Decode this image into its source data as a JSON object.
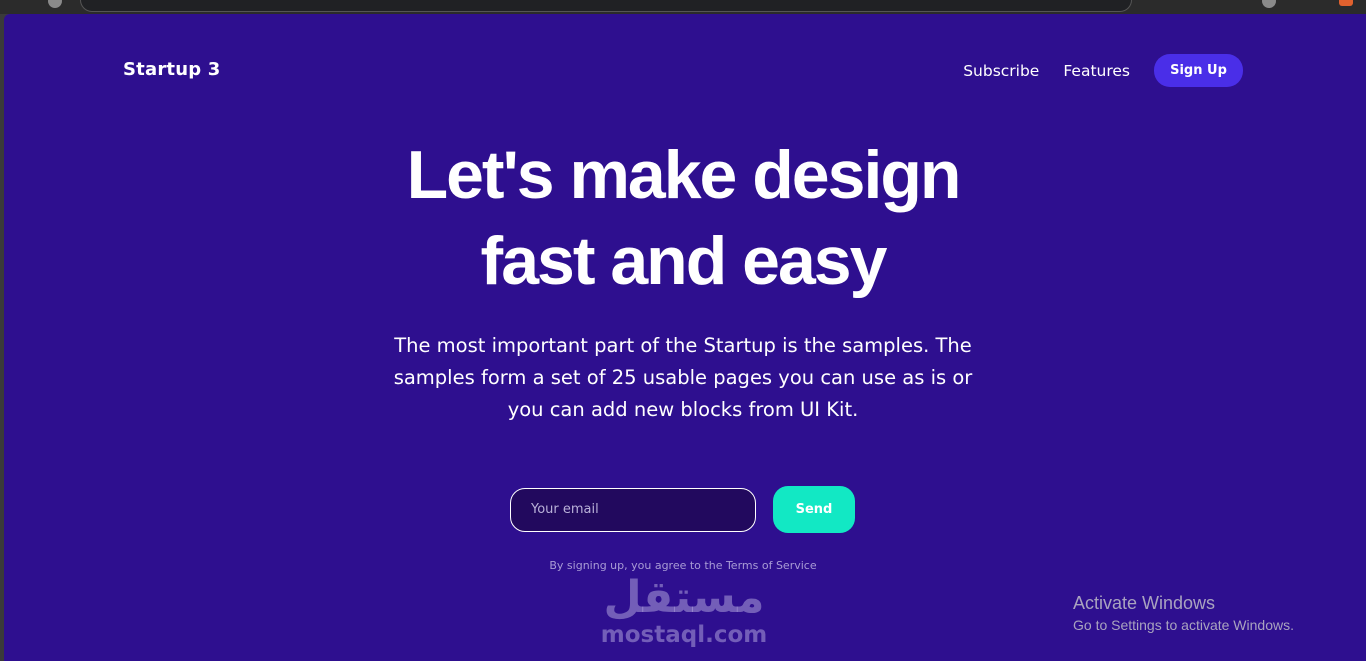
{
  "brand": {
    "logo": "Startup 3"
  },
  "nav": {
    "subscribe": "Subscribe",
    "features": "Features",
    "signup": "Sign Up"
  },
  "hero": {
    "title_line1": "Let's make design",
    "title_line2": "fast and easy",
    "subtitle": "The most important part of the Startup is the samples. The samples form a set of 25 usable pages you can use as is or you can add new blocks from UI Kit."
  },
  "signup_form": {
    "email_placeholder": "Your email",
    "email_value": "",
    "send_label": "Send",
    "terms": "By signing up, you agree to the Terms of Service"
  },
  "watermark": {
    "arabic": "مستقل",
    "latin": "mostaql.com"
  },
  "os_overlay": {
    "activate_title": "Activate Windows",
    "activate_sub": "Go to Settings to activate Windows."
  },
  "colors": {
    "background": "#2e0f8f",
    "signup_button": "#4a2ee8",
    "send_button": "#12e8c4",
    "text": "#ffffff"
  }
}
